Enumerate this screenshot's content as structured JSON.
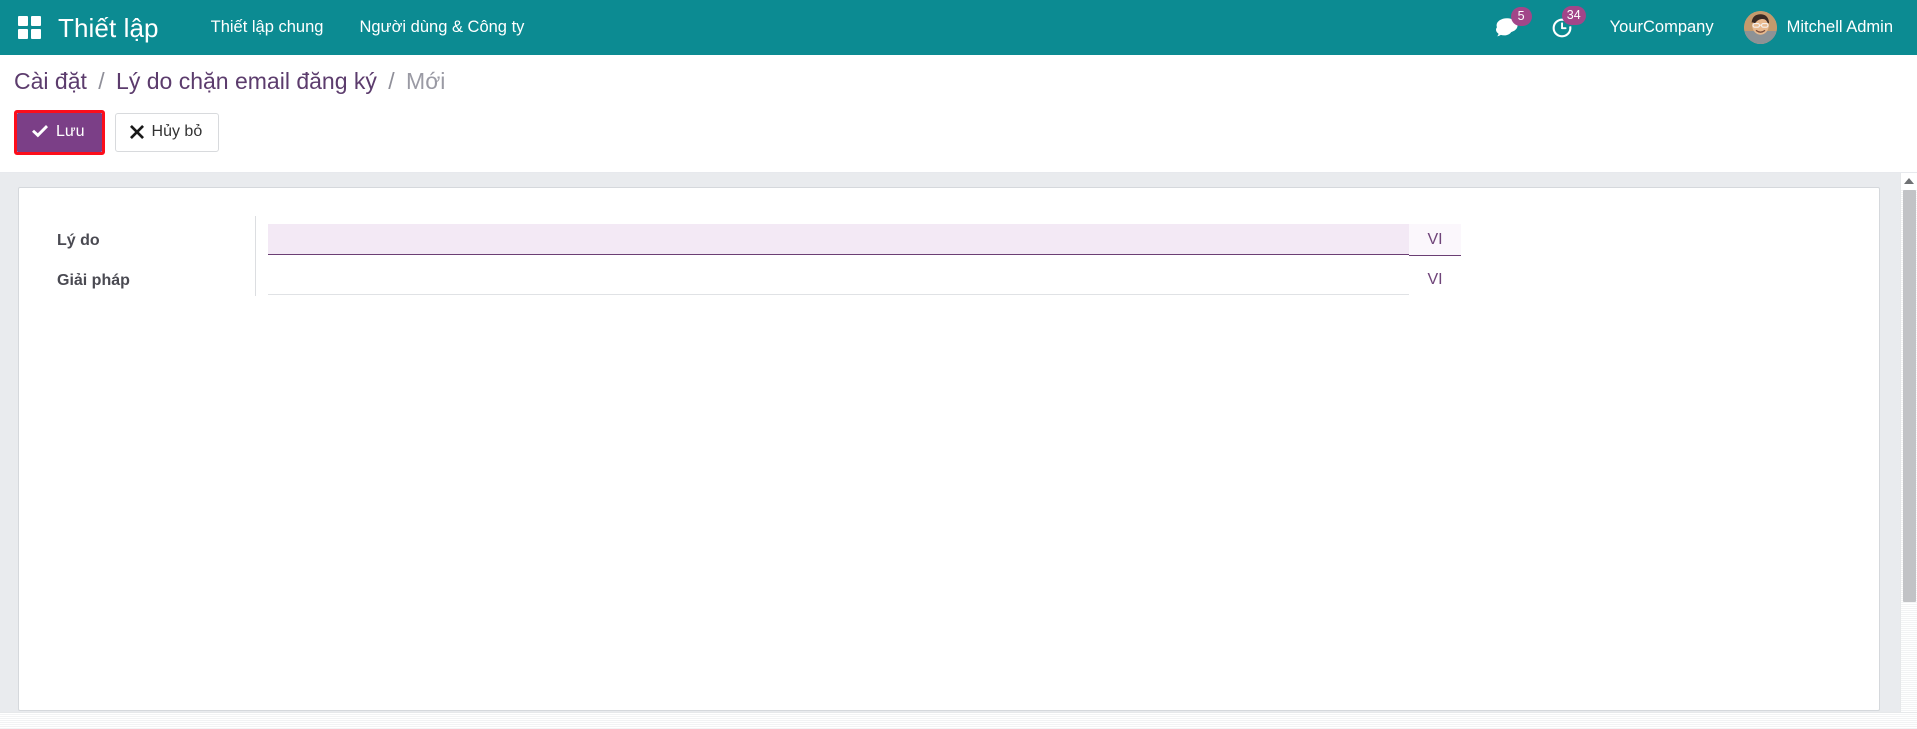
{
  "navbar": {
    "apps_icon": "apps-grid-icon",
    "brand": "Thiết lập",
    "menu_items": [
      {
        "label": "Thiết lập chung"
      },
      {
        "label": "Người dùng & Công ty"
      }
    ],
    "messages": {
      "icon": "chat-bubble-icon",
      "count": "5"
    },
    "activities": {
      "icon": "clock-activity-icon",
      "count": "34"
    },
    "company": "YourCompany",
    "user": {
      "name": "Mitchell Admin",
      "avatar": "user-avatar-photo"
    },
    "background_color": "#0c8b92",
    "badge_color": "#a24689"
  },
  "breadcrumb": {
    "items": [
      {
        "label": "Cài đặt",
        "active": false
      },
      {
        "label": "Lý do chặn email đăng ký",
        "active": false
      },
      {
        "label": "Mới",
        "active": true
      }
    ],
    "separator": "/",
    "link_color": "#5c3c6d",
    "active_color": "#9a9aa4"
  },
  "toolbar": {
    "save_label": "Lưu",
    "save_icon": "check-icon",
    "discard_label": "Hủy bỏ",
    "discard_icon": "times-icon",
    "save_highlight_color": "#fc0d1b",
    "save_background": "#7b3f87"
  },
  "form": {
    "fields": [
      {
        "label": "Lý do",
        "value": "",
        "placeholder": "",
        "lang": "VI",
        "focused": true
      },
      {
        "label": "Giải pháp",
        "value": "",
        "placeholder": "",
        "lang": "VI",
        "focused": false
      }
    ]
  },
  "scrollbars": {
    "vertical_arrow_icon": "caret-up-icon",
    "vertical_visible": true,
    "horizontal_visible": true
  }
}
